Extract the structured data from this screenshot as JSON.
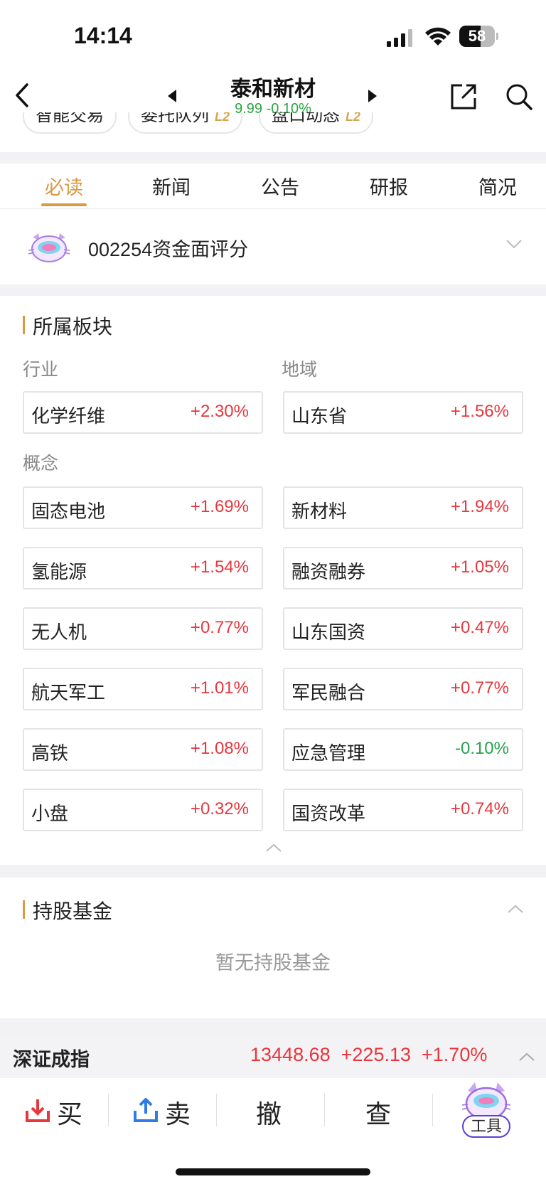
{
  "status": {
    "time": "14:14",
    "battery": "58"
  },
  "stock": {
    "name": "泰和新材",
    "price": "9.99",
    "change": "-0.10%"
  },
  "chips": [
    {
      "label": "智能交易",
      "badge": ""
    },
    {
      "label": "委托队列",
      "badge": "L2"
    },
    {
      "label": "盘口动态",
      "badge": "L2"
    }
  ],
  "tabs": [
    "必读",
    "新闻",
    "公告",
    "研报",
    "简况"
  ],
  "score": {
    "label": "002254资金面评分"
  },
  "sectors": {
    "title": "所属板块",
    "industry_label": "行业",
    "region_label": "地域",
    "concept_label": "概念",
    "industry": {
      "name": "化学纤维",
      "change": "+2.30%"
    },
    "region": {
      "name": "山东省",
      "change": "+1.56%"
    },
    "concepts": [
      {
        "name": "固态电池",
        "change": "+1.69%"
      },
      {
        "name": "新材料",
        "change": "+1.94%"
      },
      {
        "name": "氢能源",
        "change": "+1.54%"
      },
      {
        "name": "融资融券",
        "change": "+1.05%"
      },
      {
        "name": "无人机",
        "change": "+0.77%"
      },
      {
        "name": "山东国资",
        "change": "+0.47%"
      },
      {
        "name": "航天军工",
        "change": "+1.01%"
      },
      {
        "name": "军民融合",
        "change": "+0.77%"
      },
      {
        "name": "高铁",
        "change": "+1.08%"
      },
      {
        "name": "应急管理",
        "change": "-0.10%"
      },
      {
        "name": "小盘",
        "change": "+0.32%"
      },
      {
        "name": "国资改革",
        "change": "+0.74%"
      }
    ]
  },
  "funds": {
    "title": "持股基金",
    "empty": "暂无持股基金"
  },
  "index": {
    "name": "深证成指",
    "value": "13448.68",
    "change": "+225.13",
    "pct": "+1.70%"
  },
  "actions": {
    "buy": "买",
    "sell": "卖",
    "cancel": "撤",
    "query": "查",
    "tools": "工具"
  },
  "colors": {
    "up": "#e8363d",
    "down": "#26a24b",
    "accent": "#d89a45"
  }
}
